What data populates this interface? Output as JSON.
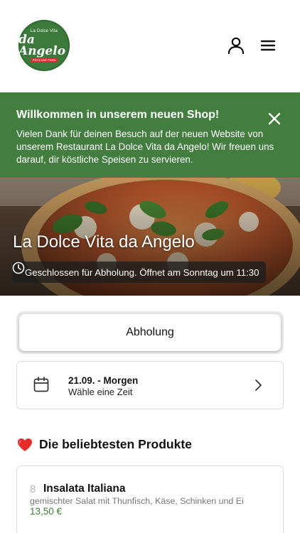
{
  "header": {
    "logo": {
      "top_text": "La Dolce Vita",
      "script_text": "da Angelo",
      "tagline": "Pizza und Pasta",
      "brand_color": "#3b7a3a"
    },
    "icons": [
      "user-icon",
      "hamburger-menu-icon"
    ]
  },
  "banner": {
    "title": "Willkommen in unserem neuen Shop!",
    "text": "Vielen Dank für deinen Besuch auf der neuen Website von unserem Restaurant La Dolce Vita da Angelo! Wir freuen uns darauf, dir köstliche Speisen zu servieren.",
    "background_color": "#437d40",
    "close_icon": "close-icon"
  },
  "hero": {
    "restaurant_name": "La Dolce Vita da Angelo",
    "status": "Geschlossen für Abholung. Öffnet am Sonntag um 11:30",
    "status_icon": "clock-icon"
  },
  "order_mode": {
    "label": "Abholung"
  },
  "time_selector": {
    "date": "21.09. - Morgen",
    "prompt": "Wähle eine Zeit",
    "icon": "calendar-icon"
  },
  "popular": {
    "title": "Die beliebtesten Produkte",
    "icon": "heart-icon",
    "products": [
      {
        "number": "8",
        "name": "Insalata Italiana",
        "description": "gemischter Salat mit Thunfisch, Käse, Schinken und Ei",
        "price": "13,50 €"
      }
    ]
  }
}
